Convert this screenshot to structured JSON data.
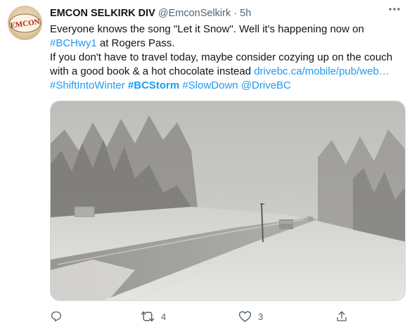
{
  "tweet": {
    "author_name": "EMCON SELKIRK DIV",
    "handle": "@EmconSelkirk",
    "separator": "·",
    "time": "5h",
    "avatar_text": "EMCON",
    "line1_text": "Everyone knows the song \"Let it Snow\". Well it's happening now on",
    "line2_hashtag": "#BCHwy1",
    "line2_text": " at Rogers Pass.",
    "line3_text": "If you don't have to travel today, maybe consider cozying up on the couch",
    "line4_text": "with a good book & a hot chocolate instead ",
    "line4_link": "drivebc.ca/mobile/pub/web…",
    "line5_hashtag1": "#ShiftIntoWinter",
    "line5_hashtag2": "#BCStorm",
    "line5_hashtag3": "#SlowDown",
    "line5_mention": "@DriveBC",
    "icons": {
      "more": "more-icon",
      "reply": "reply-icon",
      "retweet": "retweet-icon",
      "like": "like-icon",
      "share": "share-icon"
    }
  },
  "actions": {
    "reply_count": "",
    "retweet_count": "4",
    "like_count": "3"
  },
  "colors": {
    "link": "#1d9bf0",
    "text": "#0f1419",
    "secondary": "#536471"
  }
}
